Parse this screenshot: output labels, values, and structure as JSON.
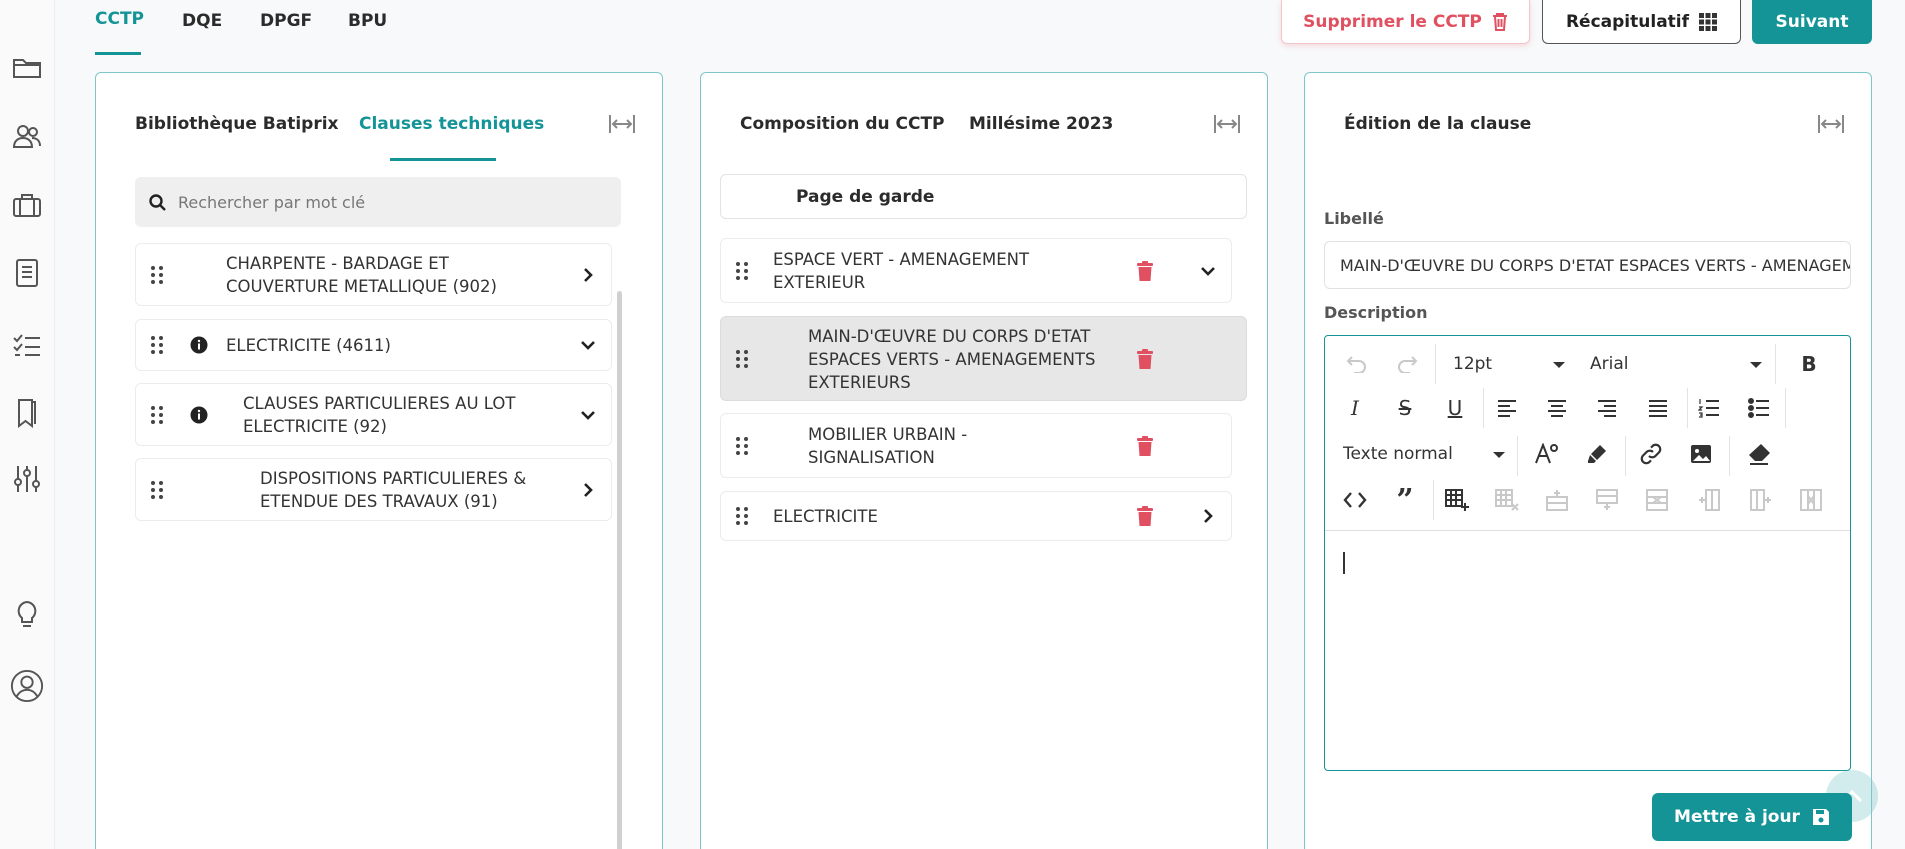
{
  "top_tabs": [
    "CCTP",
    "DQE",
    "DPGF",
    "BPU"
  ],
  "actions": {
    "delete_label": "Supprimer le CCTP",
    "recap_label": "Récapitulatif",
    "next_label": "Suivant",
    "update_label": "Mettre à jour"
  },
  "library_panel": {
    "tabs": [
      "Bibliothèque Batiprix",
      "Clauses techniques"
    ],
    "active_tab": "Clauses techniques",
    "search_placeholder": "Rechercher par mot clé",
    "items": [
      {
        "label": "CHARPENTE - BARDAGE ET COUVERTURE METALLIQUE (902)"
      },
      {
        "label": "ELECTRICITE (4611)"
      },
      {
        "label": "CLAUSES PARTICULIERES AU LOT ELECTRICITE (92)"
      },
      {
        "label": "DISPOSITIONS PARTICULIERES & ETENDUE DES TRAVAUX (91)"
      }
    ]
  },
  "composition_panel": {
    "title": "Composition du CCTP",
    "millesime": "Millésime 2023",
    "page_garde": "Page de garde",
    "items": [
      {
        "label": "ESPACE VERT - AMENAGEMENT EXTERIEUR"
      },
      {
        "label": "MAIN-D'ŒUVRE DU CORPS D'ETAT ESPACES VERTS - AMENAGEMENTS EXTERIEURS"
      },
      {
        "label": "MOBILIER URBAIN - SIGNALISATION"
      },
      {
        "label": "ELECTRICITE"
      }
    ]
  },
  "edition_panel": {
    "title": "Édition de la clause",
    "libelle_label": "Libellé",
    "libelle_value": "MAIN-D'ŒUVRE DU CORPS D'ETAT ESPACES VERTS - AMENAGEMENTS EXTERIEURS",
    "description_label": "Description",
    "font_size": "12pt",
    "font_family": "Arial",
    "block_format": "Texte normal"
  },
  "colors": {
    "accent": "#149497",
    "danger": "#e05060",
    "panel_border": "#7fc6c8"
  }
}
